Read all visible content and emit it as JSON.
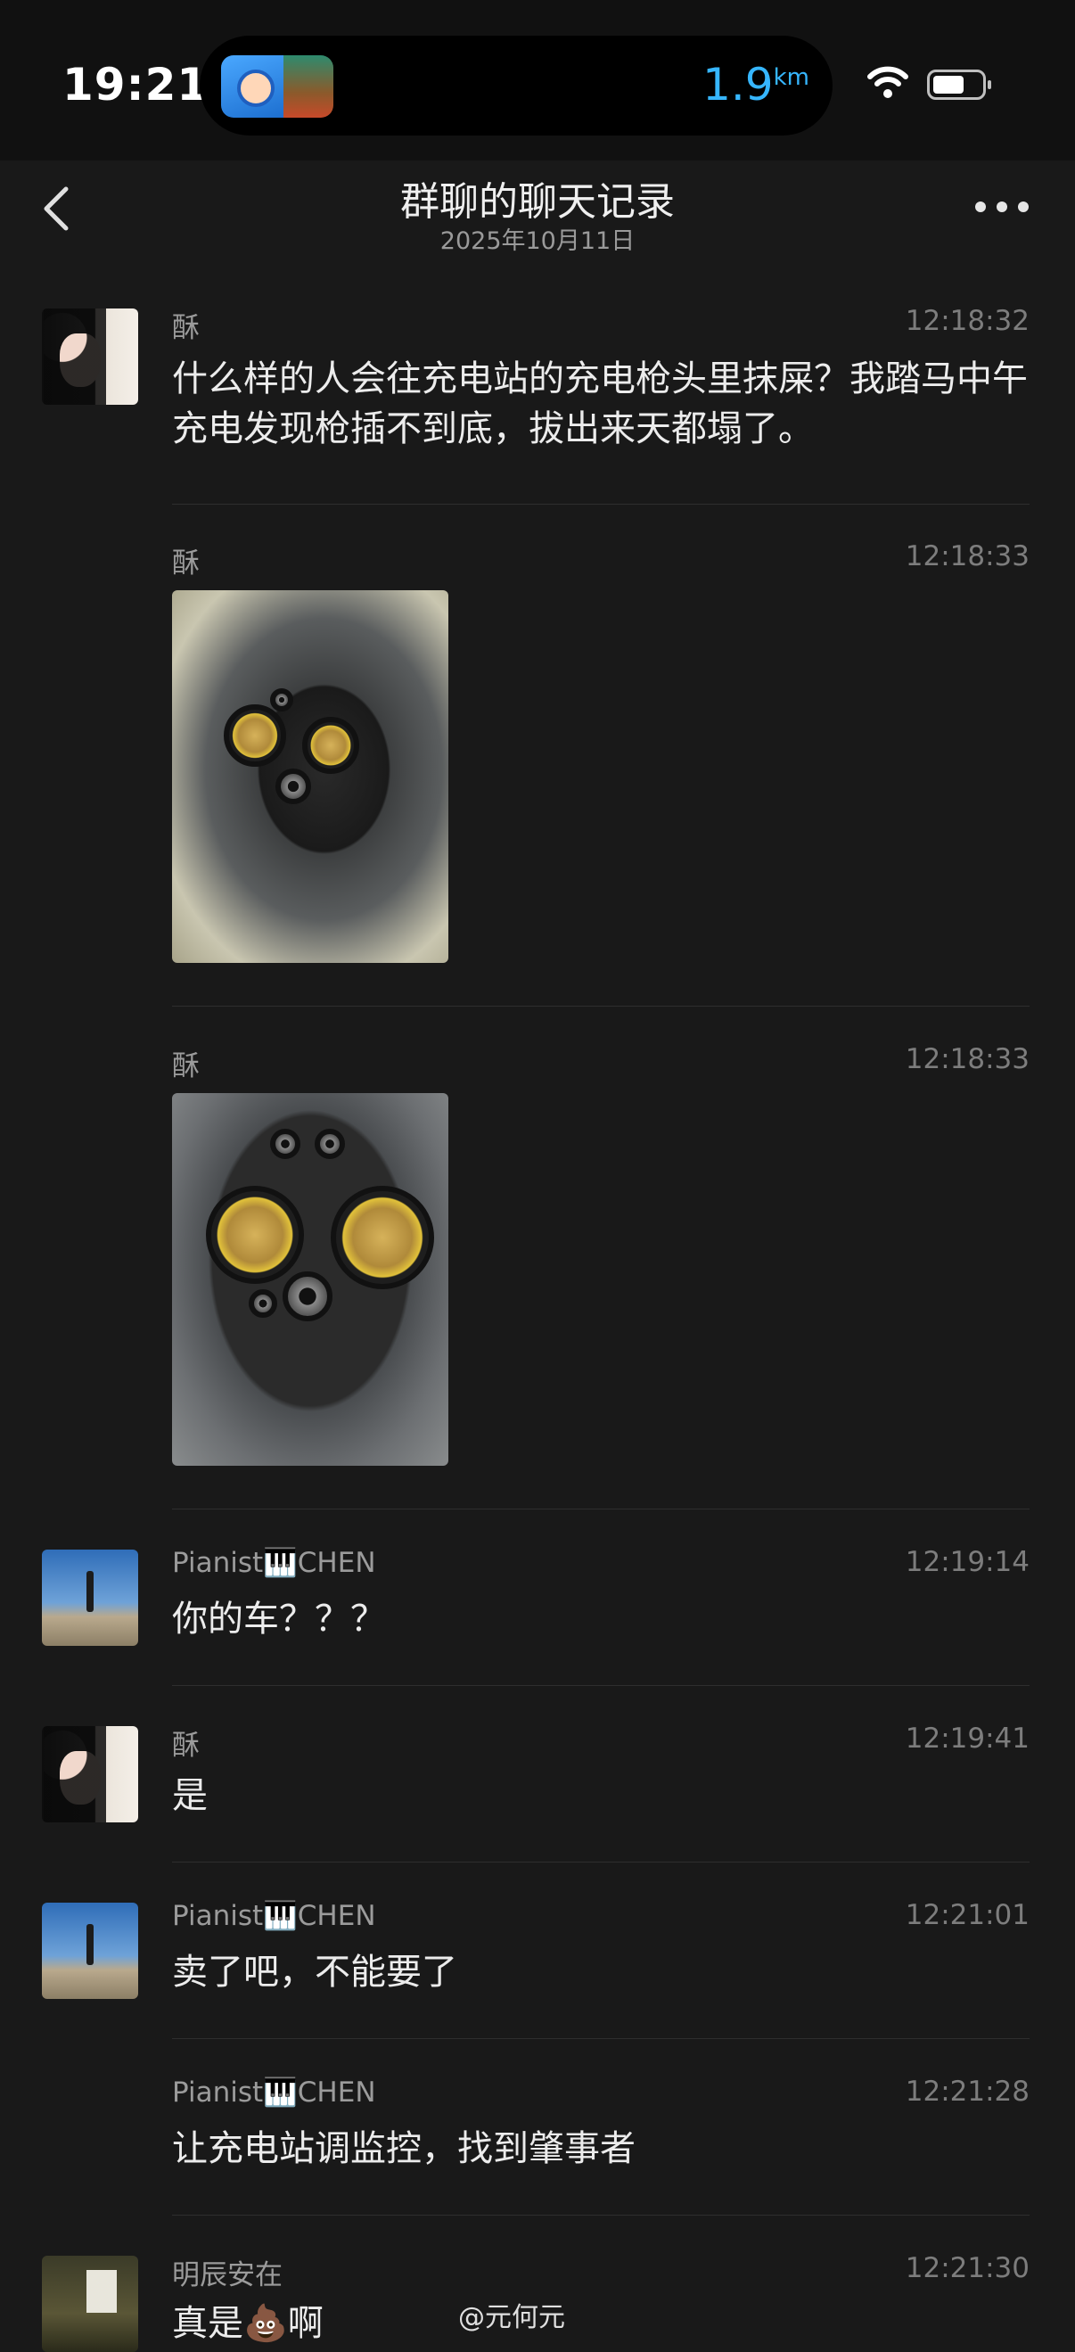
{
  "status_bar": {
    "time": "19:21",
    "distance_value": "1.9",
    "distance_unit": "km",
    "distance_color": "#36b6ff"
  },
  "header": {
    "title": "群聊的聊天记录",
    "subtitle": "2025年10月11日",
    "back_icon": "chevron-left-icon",
    "more_icon": "ellipsis-icon"
  },
  "messages": [
    {
      "sender": "酥",
      "time": "12:18:32",
      "type": "text",
      "text": "什么样的人会往充电站的充电枪头里抹屎？我踏马中午充电发现枪插不到底，拔出来天都塌了。"
    },
    {
      "sender": "酥",
      "time": "12:18:33",
      "type": "image"
    },
    {
      "sender": "酥",
      "time": "12:18:33",
      "type": "image"
    },
    {
      "sender": "Pianist🎹CHEN",
      "time": "12:19:14",
      "type": "text",
      "text": "你的车？？？"
    },
    {
      "sender": "酥",
      "time": "12:19:41",
      "type": "text",
      "text": "是"
    },
    {
      "sender": "Pianist🎹CHEN",
      "time": "12:21:01",
      "type": "text",
      "text": "卖了吧，不能要了"
    },
    {
      "sender": "Pianist🎹CHEN",
      "time": "12:21:28",
      "type": "text",
      "text": "让充电站调监控，找到肇事者"
    },
    {
      "sender": "明辰安在",
      "time": "12:21:30",
      "type": "text",
      "text": "真是💩啊"
    }
  ],
  "watermark": "@元何元"
}
